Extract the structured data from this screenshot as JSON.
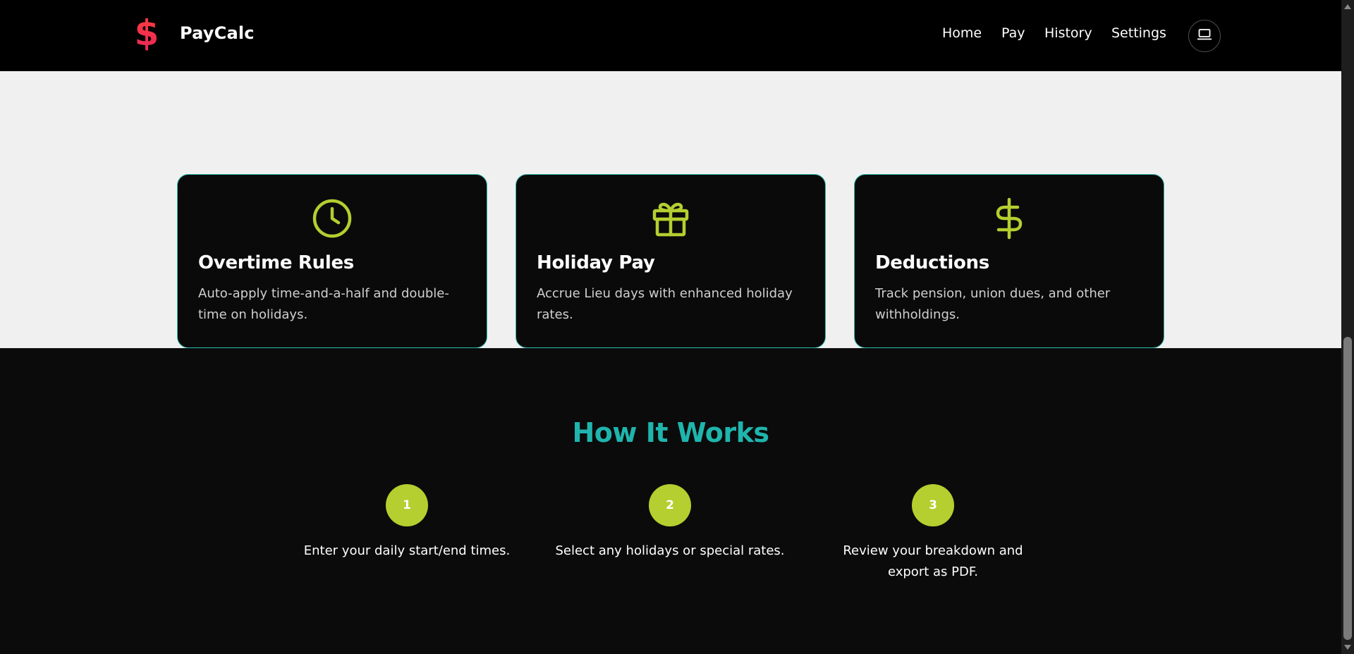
{
  "header": {
    "brand": "PayCalc",
    "logo_icon": "dollar-sign-icon",
    "nav": {
      "home": "Home",
      "pay": "Pay",
      "history": "History",
      "settings": "Settings"
    },
    "theme_toggle_icon": "laptop-icon"
  },
  "features": {
    "cards": [
      {
        "icon": "clock-icon",
        "title": "Overtime Rules",
        "description": "Auto-apply time-and-a-half and double-time on holidays."
      },
      {
        "icon": "gift-icon",
        "title": "Holiday Pay",
        "description": "Accrue Lieu days with enhanced holiday rates."
      },
      {
        "icon": "dollar-sign-icon",
        "title": "Deductions",
        "description": "Track pension, union dues, and other withholdings."
      }
    ]
  },
  "how_it_works": {
    "title": "How It Works",
    "steps": [
      {
        "number": "1",
        "text": "Enter your daily start/end times."
      },
      {
        "number": "2",
        "text": "Select any holidays or special rates."
      },
      {
        "number": "3",
        "text": "Review your breakdown and export as PDF."
      }
    ]
  },
  "colors": {
    "accent_lime": "#b4cf2f",
    "accent_teal": "#1fb5ad",
    "logo_red": "#f0304a",
    "header_bg": "#000000",
    "features_bg": "#f0f0f0",
    "card_bg": "#0a0a0a"
  }
}
